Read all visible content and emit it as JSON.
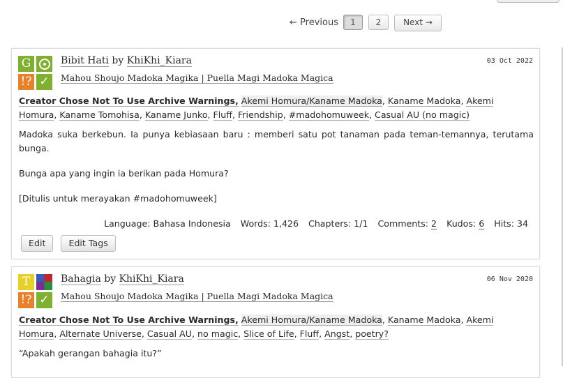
{
  "pagination": {
    "previous": "← Previous",
    "current_page": "1",
    "page_2": "2",
    "next": "Next →"
  },
  "works": [
    {
      "title": "Bibit Hati",
      "by": "by",
      "author": "KhiKhi_Kiara",
      "fandom": "Mahou Shoujo Madoka Magika | Puella Magi Madoka Magica",
      "date": "03 Oct 2022",
      "required_tags": {
        "rating": "G",
        "category": "◎",
        "warning": "!?",
        "complete": "✓"
      },
      "warning_tag": "Creator Chose Not To Use Archive Warnings,",
      "tags": [
        "Akemi Homura/Kaname Madoka",
        "Kaname Madoka",
        "Akemi Homura",
        "Kaname Tomohisa",
        "Kaname Junko",
        "Fluff",
        "Friendship",
        "#madohomuweek",
        "Casual AU (no magic)"
      ],
      "summary": [
        "Madoka suka berkebun. Ia punya kebiasaan baru : memberi satu pot tanaman pada teman-temannya, terutama bunga.",
        "Bunga apa yang ingin ia berikan pada Homura?",
        "[Ditulis untuk merayakan #madohomuweek]"
      ],
      "stats": {
        "language_label": "Language:",
        "language": "Bahasa Indonesia",
        "words_label": "Words:",
        "words": "1,426",
        "chapters_label": "Chapters:",
        "chapters": "1/1",
        "comments_label": "Comments:",
        "comments": "2",
        "kudos_label": "Kudos:",
        "kudos": "6",
        "hits_label": "Hits:",
        "hits": "34"
      },
      "buttons": {
        "edit": "Edit",
        "edit_tags": "Edit Tags"
      }
    },
    {
      "title": "Bahagia",
      "by": "by",
      "author": "KhiKhi_Kiara",
      "fandom": "Mahou Shoujo Madoka Magika | Puella Magi Madoka Magica",
      "date": "06 Nov 2020",
      "required_tags": {
        "rating": "T",
        "category": "",
        "warning": "!?",
        "complete": "✓"
      },
      "warning_tag": "Creator Chose Not To Use Archive Warnings,",
      "tags": [
        "Akemi Homura/Kaname Madoka",
        "Kaname Madoka",
        "Akemi Homura",
        "Alternate Universe",
        "Casual AU",
        "no magic",
        "Slice of Life",
        "Fluff",
        "Angst",
        "poetry?"
      ],
      "summary": [
        "“Apakah gerangan bahagia itu?”"
      ]
    }
  ]
}
